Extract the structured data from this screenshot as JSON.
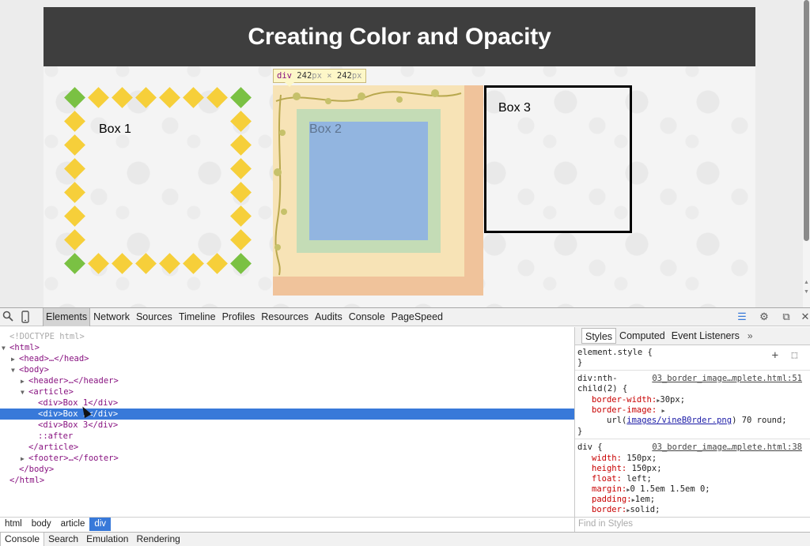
{
  "page": {
    "title": "Creating Color and Opacity",
    "box1": {
      "label": "Box 1"
    },
    "box2": {
      "label": "Box 2"
    },
    "box3": {
      "label": "Box 3"
    },
    "tooltip": {
      "tag": "div",
      "width": "242",
      "height": "242",
      "unit": "px",
      "times": " × "
    }
  },
  "devtools": {
    "tabs": [
      "Elements",
      "Network",
      "Sources",
      "Timeline",
      "Profiles",
      "Resources",
      "Audits",
      "Console",
      "PageSpeed"
    ],
    "active_tab": "Elements",
    "dom": [
      {
        "text": "<!DOCTYPE html>",
        "kind": "doctype",
        "depth": 0,
        "tri": ""
      },
      {
        "text": "<html>",
        "kind": "tag",
        "depth": 0,
        "tri": "▼"
      },
      {
        "text": "<head>…</head>",
        "kind": "tag",
        "depth": 1,
        "tri": "▶"
      },
      {
        "text": "<body>",
        "kind": "tag",
        "depth": 1,
        "tri": "▼"
      },
      {
        "text": "<header>…</header>",
        "kind": "tag",
        "depth": 2,
        "tri": "▶"
      },
      {
        "text": "<article>",
        "kind": "tag",
        "depth": 2,
        "tri": "▼"
      },
      {
        "text": "<div>Box 1</div>",
        "kind": "tag",
        "depth": 3,
        "tri": ""
      },
      {
        "text": "<div>Box 2</div>",
        "kind": "tag",
        "depth": 3,
        "tri": "",
        "selected": true
      },
      {
        "text": "<div>Box 3</div>",
        "kind": "tag",
        "depth": 3,
        "tri": ""
      },
      {
        "text": "::after",
        "kind": "pseudo",
        "depth": 3,
        "tri": ""
      },
      {
        "text": "</article>",
        "kind": "tag",
        "depth": 2,
        "tri": ""
      },
      {
        "text": "<footer>…</footer>",
        "kind": "tag",
        "depth": 2,
        "tri": "▶"
      },
      {
        "text": "</body>",
        "kind": "tag",
        "depth": 1,
        "tri": ""
      },
      {
        "text": "</html>",
        "kind": "tag",
        "depth": 0,
        "tri": ""
      }
    ],
    "styles_tabs": [
      "Styles",
      "Computed",
      "Event Listeners"
    ],
    "styles_more": "»",
    "rules": {
      "element_style": {
        "open": "element.style {",
        "close": "}"
      },
      "nth_child": {
        "selector_1": "div:nth-",
        "selector_2": "child(2) {",
        "source": "03_border_image…mplete.html:51",
        "border_width_prop": "border-width:",
        "border_width_val": "30px;",
        "border_image_prop": "border-image:",
        "url_prefix": "url(",
        "url_link": "images/vineB0rder.png",
        "url_suffix": ") 70 round;",
        "close": "}"
      },
      "div": {
        "selector": "div {",
        "source": "03_border_image…mplete.html:38",
        "width": [
          "width:",
          "150px;"
        ],
        "height": [
          "height:",
          "150px;"
        ],
        "float": [
          "float:",
          "left;"
        ],
        "margin": [
          "margin:",
          "0 1.5em 1.5em 0;"
        ],
        "padding": [
          "padding:",
          "1em;"
        ],
        "border": [
          "border:",
          "solid;"
        ]
      }
    },
    "breadcrumbs": [
      "html",
      "body",
      "article",
      "div"
    ],
    "find_styles_placeholder": "Find in Styles",
    "drawer_tabs": [
      "Console",
      "Search",
      "Emulation",
      "Rendering"
    ]
  },
  "colors": {
    "header_bg": "#3e3e3e",
    "diamond_yellow": "#f6cf3a",
    "diamond_green": "#7ac143",
    "box2_border": "#f0c39b",
    "box2_padding": "#c4dcb6",
    "box2_content": "#92b5e0",
    "selection": "#3879d9"
  }
}
